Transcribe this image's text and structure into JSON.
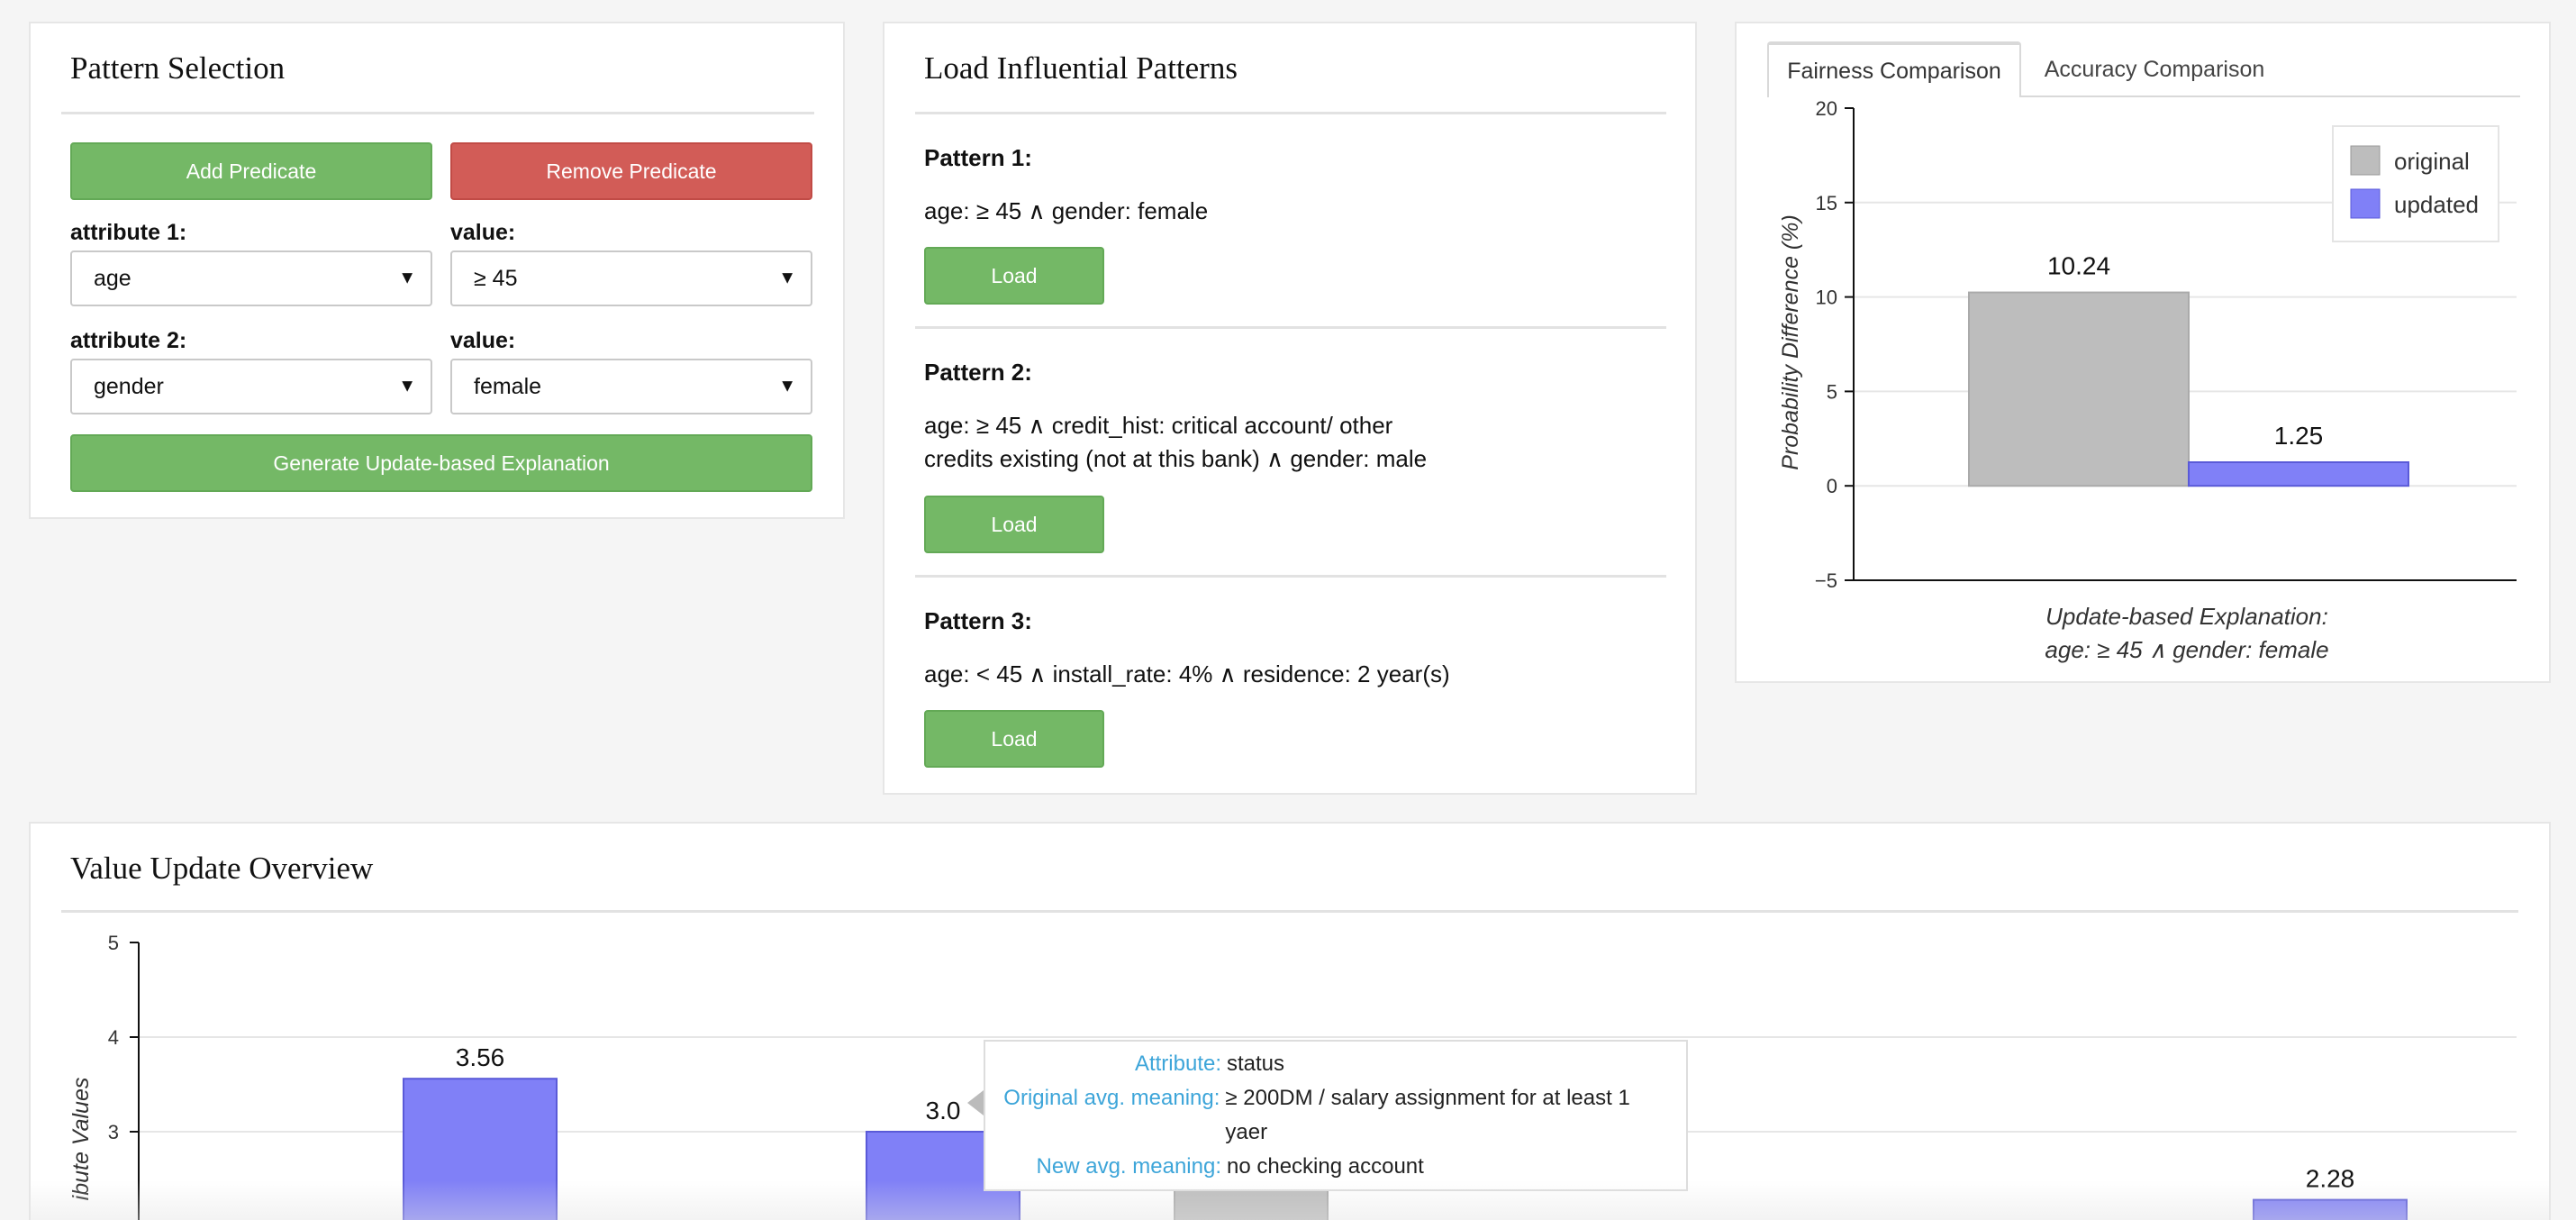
{
  "pattern_selection": {
    "title": "Pattern Selection",
    "add_label": "Add Predicate",
    "remove_label": "Remove Predicate",
    "attr1_label": "attribute 1:",
    "attr1_value": "age",
    "value1_label": "value:",
    "value1_value": "≥ 45",
    "attr2_label": "attribute 2:",
    "attr2_value": "gender",
    "value2_label": "value:",
    "value2_value": "female",
    "generate_label": "Generate Update-based Explanation"
  },
  "influential": {
    "title": "Load Influential Patterns",
    "load_label": "Load",
    "patterns": [
      {
        "title": "Pattern 1:",
        "line1": "age: ≥ 45 ∧ gender: female",
        "line2": ""
      },
      {
        "title": "Pattern 2:",
        "line1": "age: ≥ 45 ∧ credit_hist: critical account/ other",
        "line2": "credits existing (not at this bank) ∧ gender: male"
      },
      {
        "title": "Pattern 3:",
        "line1": "age: < 45 ∧ install_rate: 4% ∧ residence: 2 year(s)",
        "line2": ""
      }
    ]
  },
  "comparison": {
    "tabs": [
      "Fairness Comparison",
      "Accuracy Comparison"
    ],
    "active_tab": 0
  },
  "value_update": {
    "title": "Value Update Overview"
  },
  "tooltip": {
    "attr_key": "Attribute:",
    "attr_val": "status",
    "orig_key": "Original avg. meaning:",
    "orig_val": "≥ 200DM / salary assignment for at least 1 yaer",
    "new_key": "New avg. meaning:",
    "new_val": "no checking account"
  },
  "colors": {
    "original": "#bdbdbd",
    "updated": "#8080f7",
    "green": "#74b866",
    "red": "#d25c57",
    "tooltip_key": "#3da5d9"
  },
  "chart_data": [
    {
      "type": "bar",
      "categories": [
        "original",
        "updated"
      ],
      "values": [
        10.24,
        1.25
      ],
      "data_labels": [
        "10.24",
        "1.25"
      ],
      "ylabel": "Probability Difference (%)",
      "xlabel_line1": "Update-based Explanation:",
      "xlabel_line2": "age: ≥ 45 ∧ gender: female",
      "ylim": [
        -5,
        20
      ],
      "yticks": [
        -5,
        0,
        5,
        10,
        15,
        20
      ],
      "ytick_labels": [
        "−5",
        "0",
        "5",
        "10",
        "15",
        "20"
      ],
      "legend": [
        "original",
        "updated"
      ],
      "legend_position": "top-right",
      "grid": true
    },
    {
      "type": "bar",
      "ylabel": "ibute Values",
      "ylim_visible": [
        2,
        5
      ],
      "yticks": [
        3,
        4,
        5
      ],
      "ytick_labels": [
        "3",
        "4",
        "5"
      ],
      "bars": [
        {
          "series": "updated",
          "value": 3.56,
          "label": "3.56"
        },
        {
          "series": "updated",
          "value": 3.0,
          "label": "3.0"
        },
        {
          "series": "original",
          "value": 3.0,
          "label": ""
        },
        {
          "series": "updated",
          "value": 2.28,
          "label": "2.28"
        }
      ],
      "grid": true
    }
  ]
}
